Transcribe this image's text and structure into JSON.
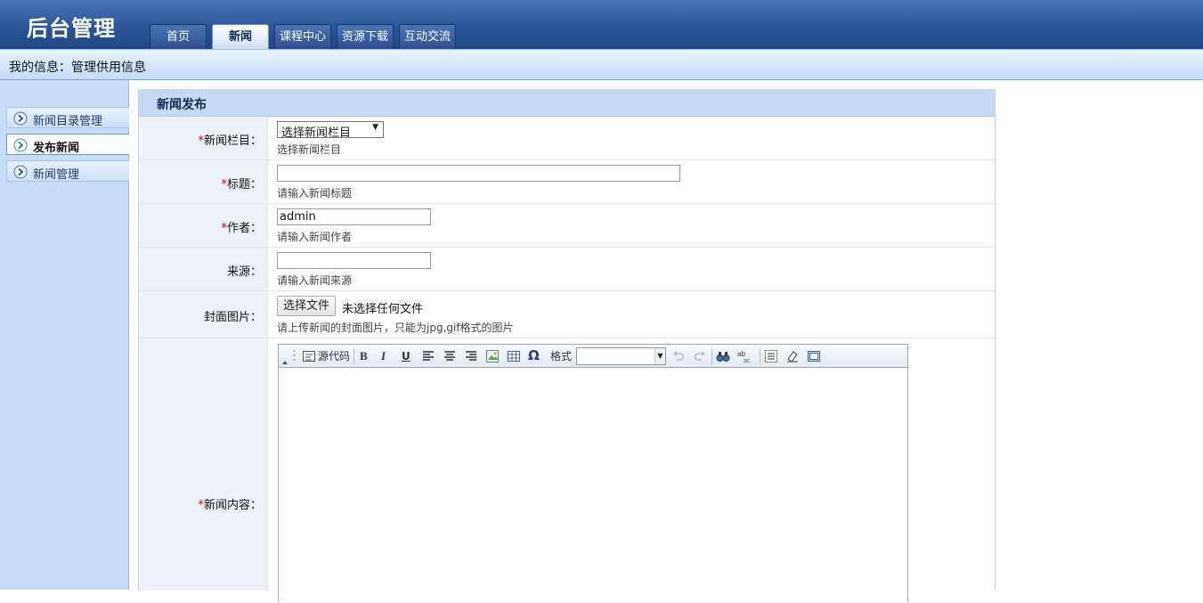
{
  "header": {
    "app_title": "后台管理",
    "tabs": [
      {
        "label": "首页",
        "active": false
      },
      {
        "label": "新闻",
        "active": true
      },
      {
        "label": "课程中心",
        "active": false
      },
      {
        "label": "资源下载",
        "active": false
      },
      {
        "label": "互动交流",
        "active": false
      }
    ]
  },
  "info_bar": {
    "text": "我的信息：管理供用信息"
  },
  "sidebar": {
    "items": [
      {
        "label": "新闻目录管理",
        "active": false
      },
      {
        "label": "发布新闻",
        "active": true
      },
      {
        "label": "新闻管理",
        "active": false
      }
    ]
  },
  "form": {
    "title": "新闻发布",
    "required_mark": "*",
    "category": {
      "label": "新闻栏目：",
      "selected": "选择新闻栏目",
      "hint": "选择新闻栏目"
    },
    "title_field": {
      "label": "标题：",
      "value": "",
      "hint": "请输入新闻标题"
    },
    "author": {
      "label": "作者：",
      "value": "admin",
      "hint": "请输入新闻作者"
    },
    "source": {
      "label": "来源：",
      "value": "",
      "hint": "请输入新闻来源"
    },
    "cover": {
      "label": "封面图片：",
      "button": "选择文件",
      "status": "未选择任何文件",
      "hint": "请上传新闻的封面图片，只能为jpg,gif格式的图片"
    },
    "content": {
      "label": "新闻内容：",
      "toolbar": {
        "source_label": "源代码",
        "bold": "B",
        "italic": "I",
        "underline": "U",
        "format_label": "格式",
        "format_value": ""
      }
    }
  },
  "colors": {
    "header": "#2c5698",
    "info_bar": "#c4dbf6",
    "sidebar": "#c8ddf7",
    "panel_head": "#c7daf5",
    "required": "#dd0000"
  }
}
